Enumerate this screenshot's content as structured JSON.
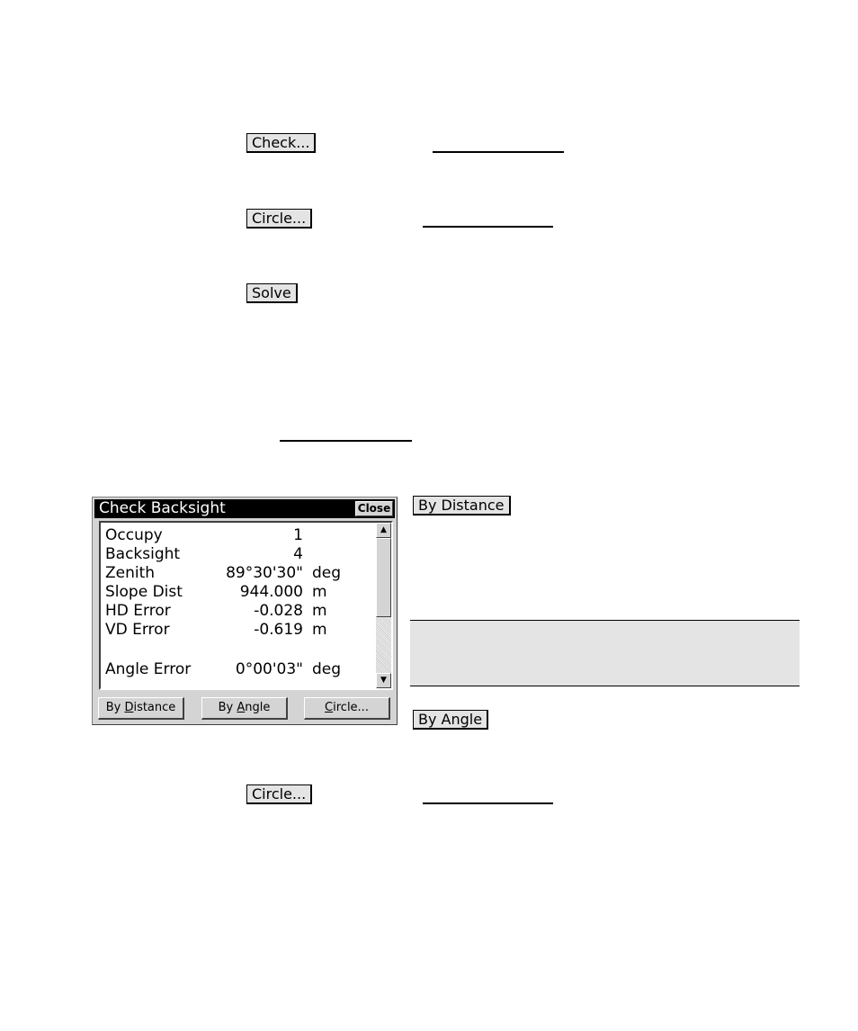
{
  "doc_buttons": {
    "check": "Check...",
    "circle_top": "Circle...",
    "solve": "Solve",
    "by_distance": "By Distance",
    "by_angle": "By Angle",
    "circle_bottom": "Circle..."
  },
  "dialog": {
    "title": "Check Backsight",
    "close_label": "Close",
    "rows": [
      {
        "label": "Occupy",
        "value": "1",
        "unit": ""
      },
      {
        "label": "Backsight",
        "value": "4",
        "unit": ""
      },
      {
        "label": "Zenith",
        "value": "89°30'30\"",
        "unit": "deg"
      },
      {
        "label": "Slope Dist",
        "value": "944.000",
        "unit": "m"
      },
      {
        "label": "HD Error",
        "value": "-0.028",
        "unit": "m"
      },
      {
        "label": "VD Error",
        "value": "-0.619",
        "unit": "m"
      },
      {
        "label": "Angle Error",
        "value": "0°00'03\"",
        "unit": "deg"
      }
    ],
    "buttons": {
      "by_distance_prefix": "By ",
      "by_distance_key": "D",
      "by_distance_rest": "istance",
      "by_angle_prefix": "By ",
      "by_angle_key": "A",
      "by_angle_rest": "ngle",
      "circle_key": "C",
      "circle_rest": "ircle..."
    },
    "scroll_up_icon": "▲",
    "scroll_down_icon": "▼"
  }
}
